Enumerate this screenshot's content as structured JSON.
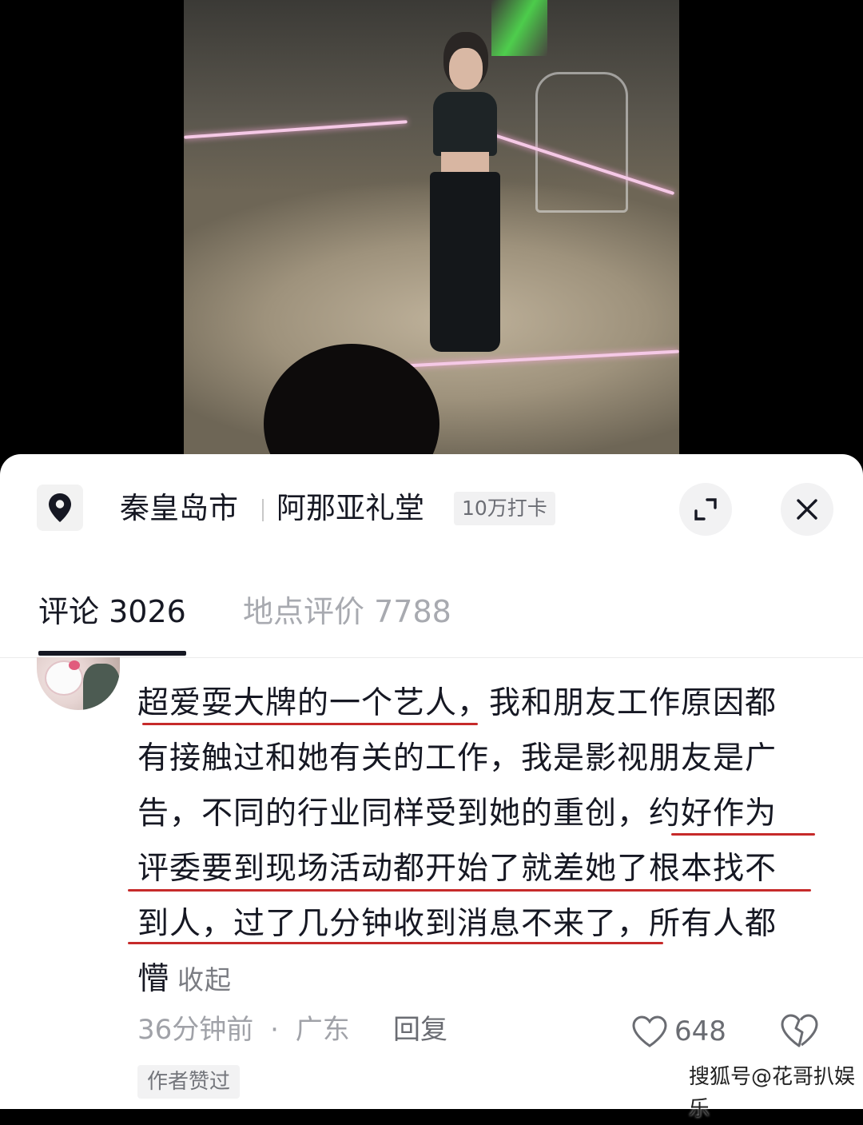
{
  "location": {
    "city": "秦皇岛市",
    "venue": "阿那亚礼堂",
    "checkins": "10万打卡",
    "icon": "location-pin-icon"
  },
  "tabs": [
    {
      "label": "评论",
      "count": "3026"
    },
    {
      "label": "地点评价",
      "count": "7788"
    }
  ],
  "comment": {
    "lines": [
      "超爱耍大牌的一个艺人，我和朋友工作原因都",
      "有接触过和她有关的工作，我是影视朋友是广",
      "告，不同的行业同样受到她的重创，约好作为",
      "评委要到现场活动都开始了就差她了根本找不",
      "到人，过了几分钟收到消息不来了，所有人都",
      "懵"
    ],
    "collapse_label": "收起",
    "time": "36分钟前",
    "region": "广东",
    "separator": "·",
    "reply_label": "回复",
    "like_count": "648",
    "author_liked": "作者赞过"
  },
  "watermark": "搜狐号@花哥扒娱乐",
  "colors": {
    "text_primary": "#161823",
    "text_secondary": "#a0a2a8",
    "underline_annotation": "#c62a2a"
  }
}
